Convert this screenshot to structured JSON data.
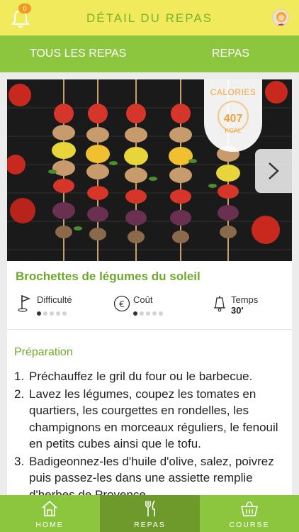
{
  "header": {
    "title": "DÉTAIL DU REPAS",
    "notification_count": "0",
    "notification_icon": "bell-icon",
    "avatar_icon": "avatar"
  },
  "tabs": {
    "all": "TOUS LES REPAS",
    "current": "REPAS"
  },
  "recipe": {
    "calories_label": "CALORIES",
    "calories_value": "407",
    "calories_unit": "KCAL",
    "title": "Brochettes de légumes du soleil",
    "difficulty": {
      "label": "Difficulté",
      "level": 1,
      "max": 5
    },
    "cost": {
      "label": "Coût",
      "level": 1,
      "max": 5
    },
    "time": {
      "label": "Temps",
      "value": "30'"
    },
    "preparation_title": "Préparation",
    "steps": [
      {
        "num": "1.",
        "text": "Préchauffez le gril du four ou le barbecue."
      },
      {
        "num": "2.",
        "text": "Lavez les légumes, coupez les tomates en quartiers, les courgettes en rondelles, les champignons en morceaux réguliers, le fenouil en petits cubes ainsi que le tofu."
      },
      {
        "num": "3.",
        "text": "Badigeonnez-les d'huile d'olive, salez, poivrez puis passez-les dans une assiette remplie d'herbes de Provence."
      }
    ]
  },
  "bottom_nav": {
    "home": "HOME",
    "repas": "REPAS",
    "course": "COURSE"
  },
  "colors": {
    "header_bg": "#f0ea5c",
    "green": "#8cc63f",
    "green_dark": "#6e9a2c",
    "title_green": "#6fa82c",
    "orange": "#f0a53a"
  }
}
